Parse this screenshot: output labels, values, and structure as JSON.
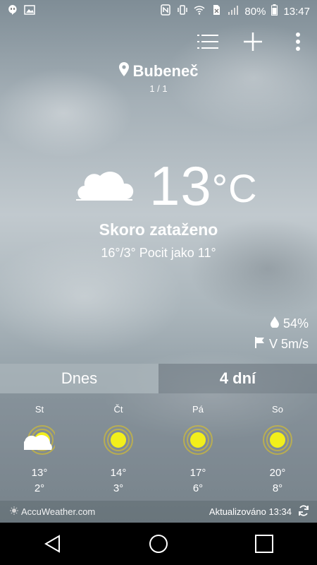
{
  "status_bar": {
    "battery": "80%",
    "time": "13:47",
    "left_icons": [
      "hangouts-icon",
      "image-icon"
    ],
    "right_icons": [
      "nfc-icon",
      "vibrate-icon",
      "wifi-icon",
      "no-sim-icon",
      "signal-icon",
      "battery-icon"
    ]
  },
  "toolbar": {
    "icons": [
      "list-icon",
      "add-icon",
      "more-icon"
    ]
  },
  "location": {
    "name": "Bubeneč",
    "page": "1 / 1"
  },
  "current": {
    "temp": "13",
    "unit": "°C",
    "condition": "Skoro zataženo",
    "hilo_feels": "16°/3° Pocit jako 11°",
    "humidity": "54%",
    "wind": "V 5m/s"
  },
  "tabs": {
    "today": "Dnes",
    "four_days": "4 dní",
    "active": "four_days"
  },
  "forecast": [
    {
      "day": "St",
      "high": "13°",
      "low": "2°",
      "icon": "partly-cloudy-icon"
    },
    {
      "day": "Čt",
      "high": "14°",
      "low": "3°",
      "icon": "sun-icon"
    },
    {
      "day": "Pá",
      "high": "17°",
      "low": "6°",
      "icon": "sun-icon"
    },
    {
      "day": "So",
      "high": "20°",
      "low": "8°",
      "icon": "sun-icon"
    }
  ],
  "footer": {
    "brand": "AccuWeather.com",
    "updated": "Aktualizováno 13:34"
  },
  "colors": {
    "sun": "#f2ef1b",
    "sun_ring": "#e6c81e",
    "navbar": "#000000"
  }
}
